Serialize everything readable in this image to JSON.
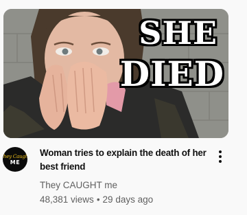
{
  "video": {
    "thumbnail": {
      "overlay_line1": "SHE",
      "overlay_line2": "DIED"
    },
    "title": "Woman tries to explain the death of her best friend",
    "channel": {
      "name": "They CAUGHT me",
      "avatar_text_top": "They Caught",
      "avatar_text_bottom": "ME",
      "avatar_icon": "channel-logo"
    },
    "views": "48,381 views",
    "separator": "•",
    "age": "29 days ago",
    "menu_icon": "more-vert-icon"
  },
  "colors": {
    "background": "#f9f9f9",
    "title": "#0f0f0f",
    "secondary_text": "#606060",
    "avatar_background": "#0b0b0b",
    "avatar_accent": "#f2c21a"
  }
}
